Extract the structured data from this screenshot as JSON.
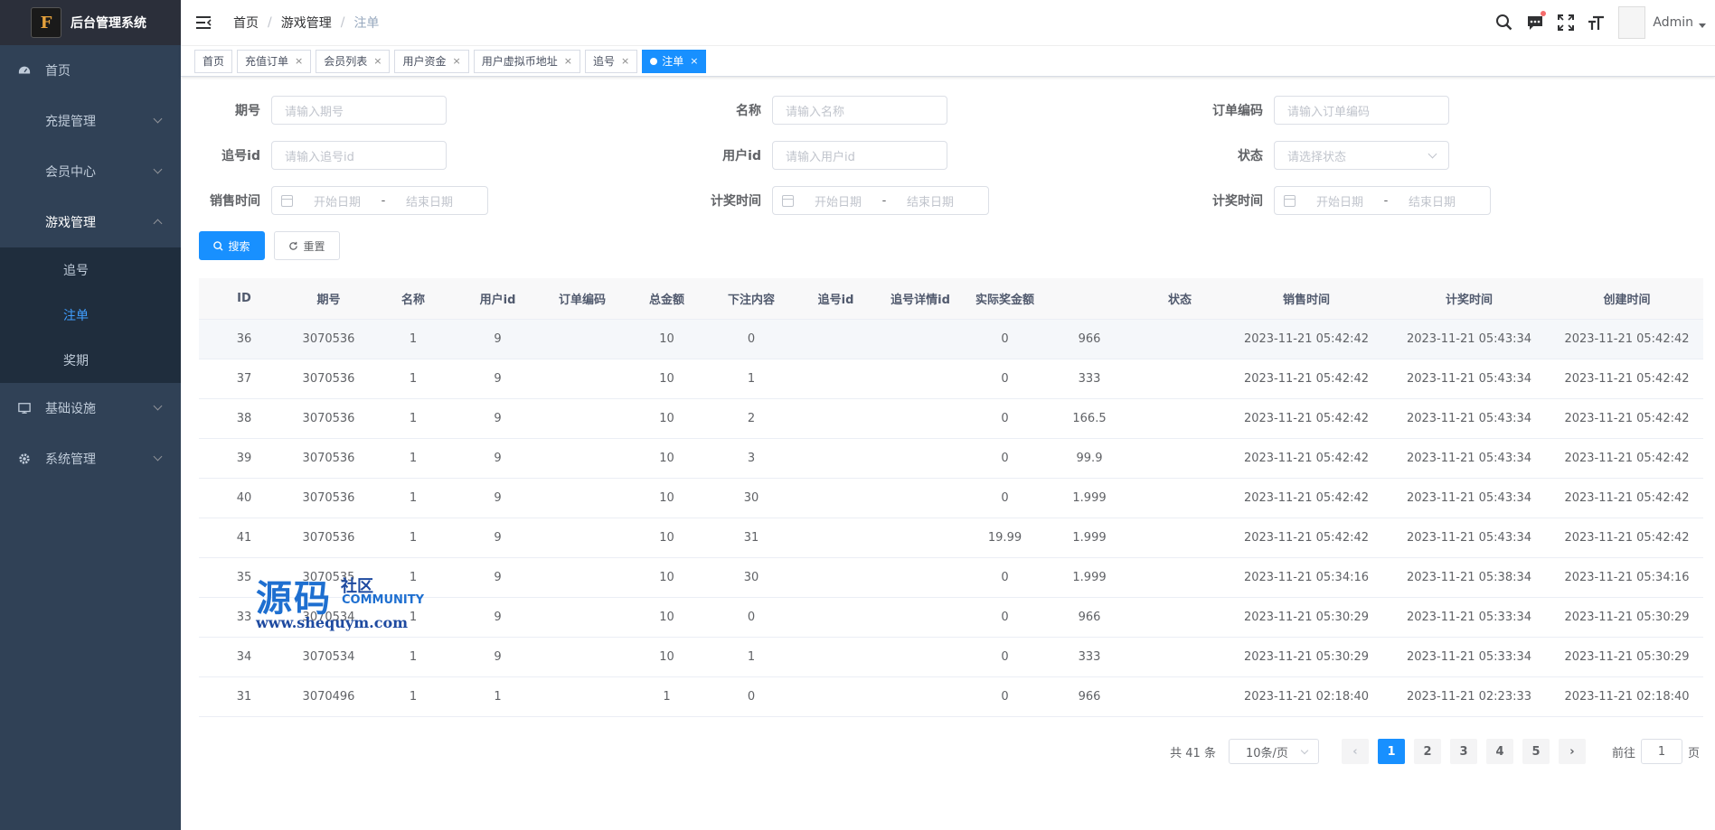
{
  "sidebar": {
    "logo_letter": "F",
    "title": "后台管理系统",
    "items": [
      {
        "label": "首页",
        "icon": "dashboard-icon"
      },
      {
        "label": "充提管理"
      },
      {
        "label": "会员中心"
      },
      {
        "label": "游戏管理",
        "open": true
      },
      {
        "label": "基础设施",
        "icon": "monitor-icon"
      },
      {
        "label": "系统管理",
        "icon": "gear-icon"
      }
    ],
    "sub_items": [
      {
        "label": "追号"
      },
      {
        "label": "注单",
        "active": true
      },
      {
        "label": "奖期"
      }
    ]
  },
  "navbar": {
    "breadcrumb": [
      "首页",
      "游戏管理",
      "注单"
    ],
    "separator": "/",
    "user": "Admin"
  },
  "tags": [
    {
      "label": "首页",
      "closable": false
    },
    {
      "label": "充值订单",
      "closable": true
    },
    {
      "label": "会员列表",
      "closable": true
    },
    {
      "label": "用户资金",
      "closable": true
    },
    {
      "label": "用户虚拟币地址",
      "closable": true
    },
    {
      "label": "追号",
      "closable": true
    },
    {
      "label": "注单",
      "closable": true,
      "active": true
    }
  ],
  "tag_close": "×",
  "form": {
    "issue": {
      "label": "期号",
      "placeholder": "请输入期号"
    },
    "name": {
      "label": "名称",
      "placeholder": "请输入名称"
    },
    "order_no": {
      "label": "订单编码",
      "placeholder": "请输入订单编码"
    },
    "chase_id": {
      "label": "追号id",
      "placeholder": "请输入追号id"
    },
    "user_id": {
      "label": "用户id",
      "placeholder": "请输入用户id"
    },
    "status": {
      "label": "状态",
      "placeholder": "请选择状态"
    },
    "sale_time": {
      "label": "销售时间"
    },
    "prize_time_1": {
      "label": "计奖时间"
    },
    "prize_time_2": {
      "label": "计奖时间"
    },
    "date_start": "开始日期",
    "date_end": "结束日期",
    "date_sep": "-",
    "search_label": "搜索",
    "reset_label": "重置"
  },
  "table": {
    "headers": [
      "ID",
      "期号",
      "名称",
      "用户id",
      "订单编码",
      "总金额",
      "下注内容",
      "追号id",
      "追号详情id",
      "实际奖金额",
      "",
      "状态",
      "销售时间",
      "计奖时间",
      "创建时间"
    ],
    "rows": [
      [
        "36",
        "3070536",
        "1",
        "9",
        "",
        "10",
        "0",
        "",
        "",
        "0",
        "966",
        "",
        "2023-11-21 05:42:42",
        "2023-11-21 05:43:34",
        "2023-11-21 05:42:42"
      ],
      [
        "37",
        "3070536",
        "1",
        "9",
        "",
        "10",
        "1",
        "",
        "",
        "0",
        "333",
        "",
        "2023-11-21 05:42:42",
        "2023-11-21 05:43:34",
        "2023-11-21 05:42:42"
      ],
      [
        "38",
        "3070536",
        "1",
        "9",
        "",
        "10",
        "2",
        "",
        "",
        "0",
        "166.5",
        "",
        "2023-11-21 05:42:42",
        "2023-11-21 05:43:34",
        "2023-11-21 05:42:42"
      ],
      [
        "39",
        "3070536",
        "1",
        "9",
        "",
        "10",
        "3",
        "",
        "",
        "0",
        "99.9",
        "",
        "2023-11-21 05:42:42",
        "2023-11-21 05:43:34",
        "2023-11-21 05:42:42"
      ],
      [
        "40",
        "3070536",
        "1",
        "9",
        "",
        "10",
        "30",
        "",
        "",
        "0",
        "1.999",
        "",
        "2023-11-21 05:42:42",
        "2023-11-21 05:43:34",
        "2023-11-21 05:42:42"
      ],
      [
        "41",
        "3070536",
        "1",
        "9",
        "",
        "10",
        "31",
        "",
        "",
        "19.99",
        "1.999",
        "",
        "2023-11-21 05:42:42",
        "2023-11-21 05:43:34",
        "2023-11-21 05:42:42"
      ],
      [
        "35",
        "3070535",
        "1",
        "9",
        "",
        "10",
        "30",
        "",
        "",
        "0",
        "1.999",
        "",
        "2023-11-21 05:34:16",
        "2023-11-21 05:38:34",
        "2023-11-21 05:34:16"
      ],
      [
        "33",
        "3070534",
        "1",
        "9",
        "",
        "10",
        "0",
        "",
        "",
        "0",
        "966",
        "",
        "2023-11-21 05:30:29",
        "2023-11-21 05:33:34",
        "2023-11-21 05:30:29"
      ],
      [
        "34",
        "3070534",
        "1",
        "9",
        "",
        "10",
        "1",
        "",
        "",
        "0",
        "333",
        "",
        "2023-11-21 05:30:29",
        "2023-11-21 05:33:34",
        "2023-11-21 05:30:29"
      ],
      [
        "31",
        "3070496",
        "1",
        "1",
        "",
        "1",
        "0",
        "",
        "",
        "0",
        "966",
        "",
        "2023-11-21 02:18:40",
        "2023-11-21 02:23:33",
        "2023-11-21 02:18:40"
      ]
    ]
  },
  "pagination": {
    "total": "共 41 条",
    "page_size": "10条/页",
    "pages": [
      "1",
      "2",
      "3",
      "4",
      "5"
    ],
    "current": "1",
    "prev": "‹",
    "next": "›",
    "goto_prefix": "前往",
    "goto_value": "1",
    "goto_suffix": "页"
  },
  "watermark": {
    "big": "源码",
    "cn": "社区",
    "en": "COMMUNITY",
    "url": "www.shequym.com"
  },
  "colors": {
    "sidebar_bg": "#304156",
    "submenu_bg": "#1f2d3d",
    "primary": "#1890ff"
  }
}
